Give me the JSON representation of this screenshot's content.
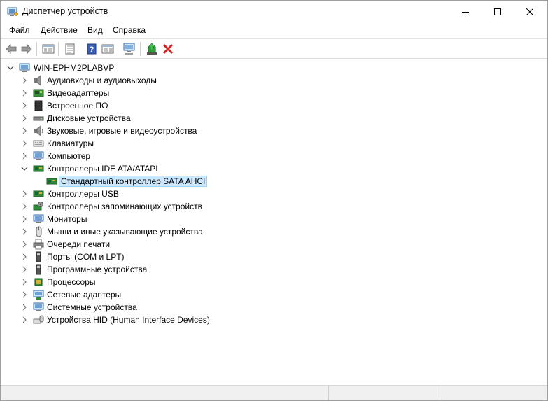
{
  "window": {
    "title": "Диспетчер устройств"
  },
  "menu": [
    {
      "label": "Файл"
    },
    {
      "label": "Действие"
    },
    {
      "label": "Вид"
    },
    {
      "label": "Справка"
    }
  ],
  "toolbar": {
    "buttons": [
      {
        "icon": "back-arrow-icon"
      },
      {
        "icon": "forward-arrow-icon"
      },
      {
        "icon": "console-tree-icon"
      },
      {
        "icon": "properties-icon"
      },
      {
        "icon": "help-icon"
      },
      {
        "icon": "action-pane-icon"
      },
      {
        "icon": "scan-hardware-icon"
      },
      {
        "icon": "update-driver-icon"
      },
      {
        "icon": "uninstall-device-icon"
      }
    ],
    "colors": {
      "uninstall": "#d02020",
      "update": "#2f9e3a",
      "help": "#3b5fb5"
    }
  },
  "tree": {
    "root": {
      "label": "WIN-EPHM2PLABVP",
      "expanded": true
    },
    "categories": [
      {
        "label": "Аудиовходы и аудиовыходы",
        "icon": "speaker-icon",
        "expanded": false
      },
      {
        "label": "Видеоадаптеры",
        "icon": "display-adapter-icon",
        "expanded": false
      },
      {
        "label": "Встроенное ПО",
        "icon": "firmware-icon",
        "expanded": false
      },
      {
        "label": "Дисковые устройства",
        "icon": "disk-drive-icon",
        "expanded": false
      },
      {
        "label": "Звуковые, игровые и видеоустройства",
        "icon": "sound-icon",
        "expanded": false
      },
      {
        "label": "Клавиатуры",
        "icon": "keyboard-icon",
        "expanded": false
      },
      {
        "label": "Компьютер",
        "icon": "computer-icon",
        "expanded": false
      },
      {
        "label": "Контроллеры IDE ATA/ATAPI",
        "icon": "ide-controller-icon",
        "expanded": true,
        "children": [
          {
            "label": "Стандартный контроллер SATA AHCI",
            "icon": "sata-controller-icon",
            "selected": true
          }
        ]
      },
      {
        "label": "Контроллеры USB",
        "icon": "usb-icon",
        "expanded": false
      },
      {
        "label": "Контроллеры запоминающих устройств",
        "icon": "storage-controller-icon",
        "expanded": false
      },
      {
        "label": "Мониторы",
        "icon": "monitor-icon",
        "expanded": false
      },
      {
        "label": "Мыши и иные указывающие устройства",
        "icon": "mouse-icon",
        "expanded": false
      },
      {
        "label": "Очереди печати",
        "icon": "printer-icon",
        "expanded": false
      },
      {
        "label": "Порты (COM и LPT)",
        "icon": "port-icon",
        "expanded": false
      },
      {
        "label": "Программные устройства",
        "icon": "software-device-icon",
        "expanded": false
      },
      {
        "label": "Процессоры",
        "icon": "processor-icon",
        "expanded": false
      },
      {
        "label": "Сетевые адаптеры",
        "icon": "network-adapter-icon",
        "expanded": false
      },
      {
        "label": "Системные устройства",
        "icon": "system-device-icon",
        "expanded": false
      },
      {
        "label": "Устройства HID (Human Interface Devices)",
        "icon": "hid-icon",
        "expanded": false
      }
    ]
  }
}
